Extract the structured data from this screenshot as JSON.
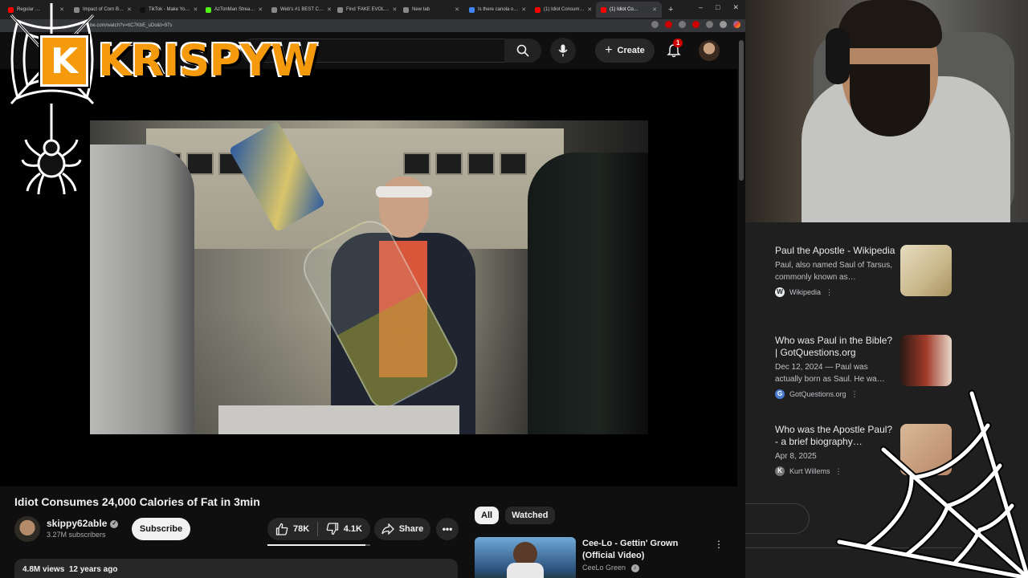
{
  "browser": {
    "tabs": [
      {
        "label": "Regular …",
        "color": "#ff0000"
      },
      {
        "label": "Impact of Corn B…",
        "color": "#888888"
      },
      {
        "label": "TikTok - Make Yo…",
        "color": "#111111"
      },
      {
        "label": "AzTonMan Strea…",
        "color": "#53fc18"
      },
      {
        "label": "Web's #1 BEST C…",
        "color": "#888888"
      },
      {
        "label": "Find 'FAKE EVOL…",
        "color": "#888888"
      },
      {
        "label": "New tab",
        "color": "#888888"
      },
      {
        "label": "Is there canola o…",
        "color": "#4285f4"
      },
      {
        "label": "(1) Idiot Consum…",
        "color": "#ff0000"
      },
      {
        "label": "(1) Idiot Co…",
        "color": "#ff0000"
      }
    ],
    "new_tab": "+",
    "window_controls": [
      "–",
      "□",
      "✕"
    ],
    "url": "be.com/watch?v=ttC7KbE_uDo&t=97s"
  },
  "header": {
    "create_label": "Create",
    "notification_count": "1"
  },
  "video": {
    "title": "Idiot Consumes 24,000 Calories of Fat in 3min",
    "channel": "skippy62able",
    "subscribers": "3.27M subscribers",
    "subscribe_label": "Subscribe",
    "likes": "78K",
    "dislikes": "4.1K",
    "like_ratio": 0.95,
    "share_label": "Share",
    "more_label": "•••",
    "views": "4.8M views",
    "age": "12 years ago"
  },
  "recommendations": {
    "chips": [
      "All",
      "Watched"
    ],
    "items": [
      {
        "title": "Cee-Lo - Gettin' Grown (Official Video)",
        "channel": "CeeLo Green"
      }
    ]
  },
  "side_panel": {
    "results": [
      {
        "title": "Paul the Apostle - Wikipedia",
        "snippet": "Paul, also named Saul of Tarsus, commonly known as…",
        "source": "Wikipedia",
        "icon": "W"
      },
      {
        "title": "Who was Paul in the Bible? | GotQuestions.org",
        "snippet": "Dec 12, 2024 — Paul was actually born as Saul. He wa…",
        "source": "GotQuestions.org",
        "icon": "G"
      },
      {
        "title": "Who was the Apostle Paul? - a brief biography…",
        "snippet": "Apr 8, 2025",
        "source": "Kurt Willems",
        "icon": "K"
      }
    ],
    "menu_icon": "⋮"
  },
  "overlay": {
    "logo_letter": "K",
    "logo_text": "KRISPYW"
  },
  "colors": {
    "accent_orange": "#f59a0c",
    "yt_red": "#cc0000",
    "background": "#0f0f0f"
  }
}
